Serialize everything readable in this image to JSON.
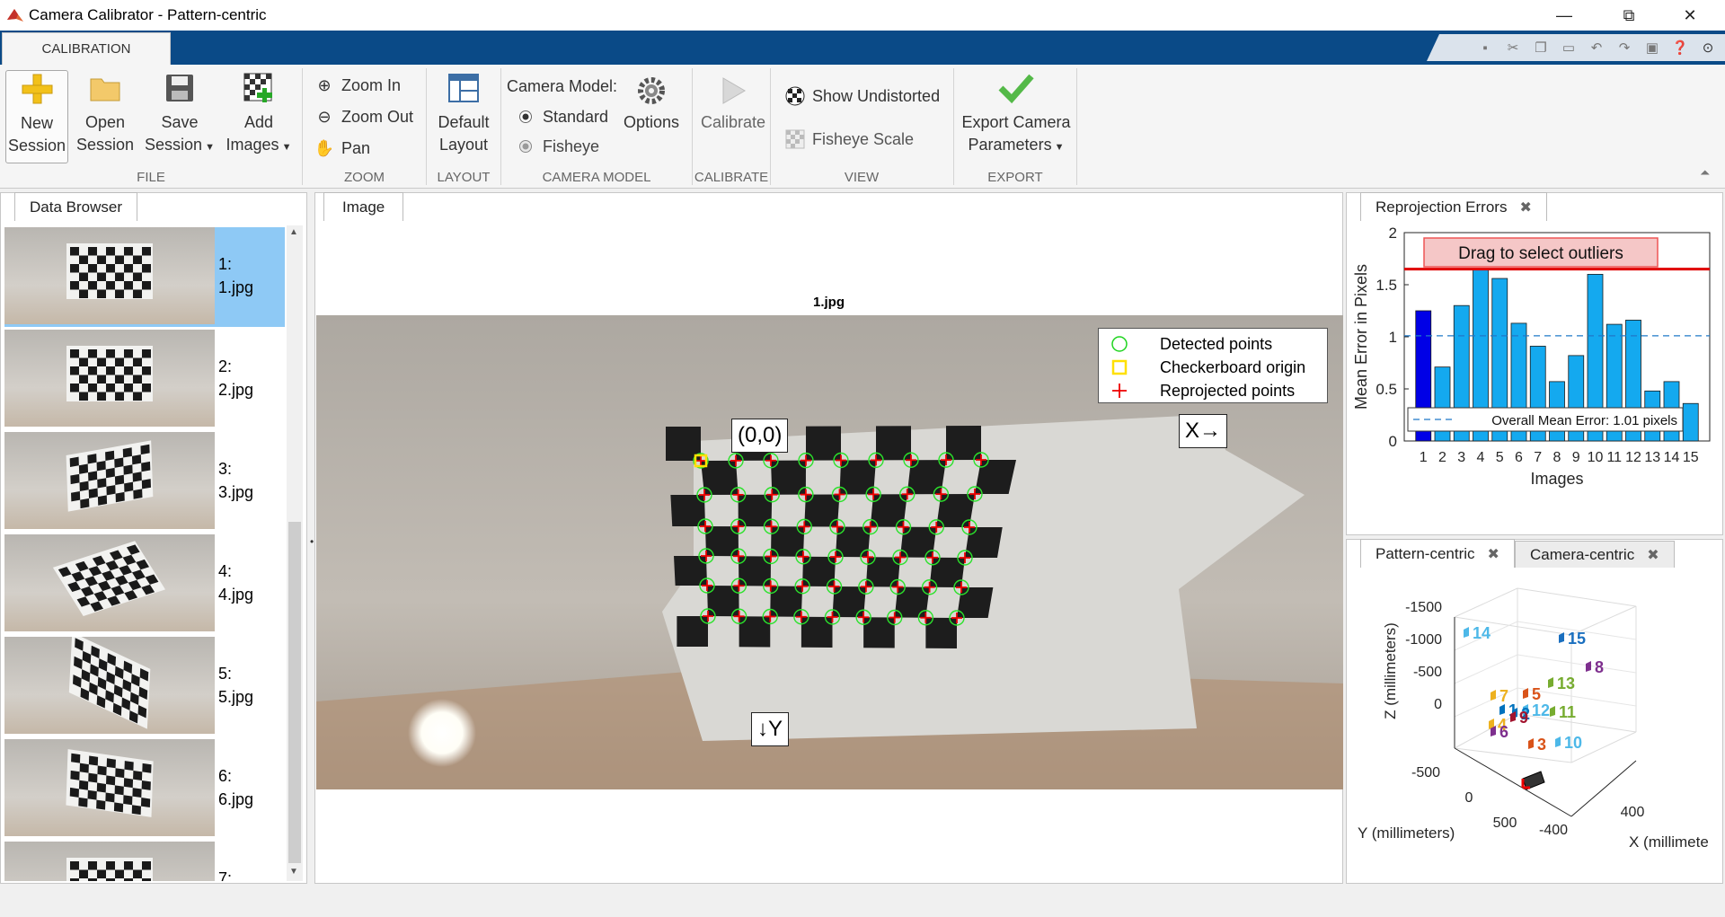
{
  "window": {
    "title": "Camera Calibrator - Pattern-centric",
    "minimize": "—",
    "maximize": "⧉",
    "close": "✕"
  },
  "ribbon": {
    "tab": "CALIBRATION",
    "file": {
      "new_line1": "New",
      "new_line2": "Session",
      "open_line1": "Open",
      "open_line2": "Session",
      "save_line1": "Save",
      "save_line2": "Session",
      "add_line1": "Add",
      "add_line2": "Images",
      "label": "FILE"
    },
    "zoom": {
      "zoom_in": "Zoom In",
      "zoom_out": "Zoom Out",
      "pan": "Pan",
      "label": "ZOOM"
    },
    "layout": {
      "default_line1": "Default",
      "default_line2": "Layout",
      "label": "LAYOUT"
    },
    "camera_model": {
      "title": "Camera Model:",
      "standard": "Standard",
      "fisheye": "Fisheye",
      "options": "Options",
      "label": "CAMERA MODEL",
      "selected": "Standard"
    },
    "calibrate": {
      "button": "Calibrate",
      "label": "CALIBRATE"
    },
    "view": {
      "show_undistorted": "Show Undistorted",
      "fisheye_scale": "Fisheye Scale",
      "label": "VIEW"
    },
    "export": {
      "line1": "Export Camera",
      "line2": "Parameters",
      "label": "EXPORT"
    }
  },
  "browser": {
    "tab": "Data Browser",
    "items": [
      {
        "index": "1:",
        "file": "1.jpg",
        "selected": true
      },
      {
        "index": "2:",
        "file": "2.jpg"
      },
      {
        "index": "3:",
        "file": "3.jpg"
      },
      {
        "index": "4:",
        "file": "4.jpg"
      },
      {
        "index": "5:",
        "file": "5.jpg"
      },
      {
        "index": "6:",
        "file": "6.jpg"
      },
      {
        "index": "7:",
        "file": ""
      }
    ]
  },
  "image_panel": {
    "tab": "Image",
    "figure_title": "1.jpg",
    "origin_label": "(0,0)",
    "x_label": "X→",
    "y_label": "↓Y",
    "legend": [
      "Detected points",
      "Checkerboard origin",
      "Reprojected points"
    ]
  },
  "reprojection": {
    "tab": "Reprojection Errors",
    "banner": "Drag to select outliers",
    "legend": "Overall Mean Error: 1.01 pixels"
  },
  "extrinsics": {
    "tabs": [
      "Pattern-centric",
      "Camera-centric"
    ],
    "active": "Pattern-centric",
    "zlabel": "Z (millimeters)",
    "ylabel": "Y (millimeters)",
    "xlabel": "X (millimete",
    "zticks": [
      "-1500",
      "-1000",
      "-500",
      "0"
    ],
    "yticks": [
      "-500",
      "0",
      "500"
    ],
    "xticks": [
      "-400",
      "400"
    ],
    "cams": [
      {
        "id": "14",
        "color": "#4db8e8"
      },
      {
        "id": "15",
        "color": "#1a6fbf"
      },
      {
        "id": "8",
        "color": "#7e2f8e"
      },
      {
        "id": "13",
        "color": "#77ac30"
      },
      {
        "id": "7",
        "color": "#edb120"
      },
      {
        "id": "5",
        "color": "#d95319"
      },
      {
        "id": "1",
        "color": "#0072bd"
      },
      {
        "id": "12",
        "color": "#4db8e8"
      },
      {
        "id": "2",
        "color": "#0072bd"
      },
      {
        "id": "11",
        "color": "#77ac30"
      },
      {
        "id": "4",
        "color": "#edb120"
      },
      {
        "id": "9",
        "color": "#a2142f"
      },
      {
        "id": "6",
        "color": "#7e2f8e"
      },
      {
        "id": "3",
        "color": "#d95319"
      },
      {
        "id": "10",
        "color": "#4db8e8"
      }
    ]
  },
  "chart_data": {
    "type": "bar",
    "categories": [
      "1",
      "2",
      "3",
      "4",
      "5",
      "6",
      "7",
      "8",
      "9",
      "10",
      "11",
      "12",
      "13",
      "14",
      "15"
    ],
    "values": [
      1.25,
      0.71,
      1.3,
      1.65,
      1.56,
      1.13,
      0.91,
      0.57,
      0.82,
      1.6,
      1.12,
      1.16,
      0.48,
      0.57,
      0.36
    ],
    "highlighted": [
      "1"
    ],
    "mean": 1.01,
    "threshold": 1.65,
    "xlabel": "Images",
    "ylabel": "Mean Error in Pixels",
    "ylim": [
      0,
      2
    ],
    "yticks": [
      "0",
      "0.5",
      "1",
      "1.5",
      "2"
    ],
    "colors": {
      "bar": "#14a9ef",
      "selected": "#0000e6",
      "mean": "#1f78c8",
      "threshold": "#e00000"
    }
  }
}
